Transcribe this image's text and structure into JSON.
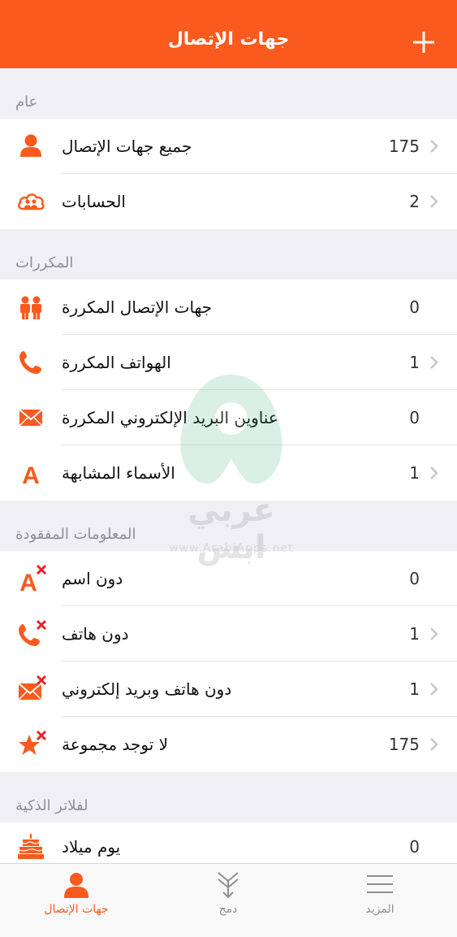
{
  "colors": {
    "accent": "#fa5a1e",
    "cross": "#e8232a",
    "background": "#efeff4"
  },
  "header": {
    "title": "جهات الإتصال",
    "add_icon": "plus-icon"
  },
  "sections": [
    {
      "title": "عام",
      "rows": [
        {
          "label": "جميع جهات الإتصال",
          "count": "175",
          "icon": "person-icon",
          "chevron": true
        },
        {
          "label": "الحسابات",
          "count": "2",
          "icon": "cloud-users-icon",
          "chevron": true
        }
      ]
    },
    {
      "title": "المكررات",
      "rows": [
        {
          "label": "جهات الإتصال المكررة",
          "count": "0",
          "icon": "people-icon",
          "chevron": false
        },
        {
          "label": "الهواتف المكررة",
          "count": "1",
          "icon": "phone-icon",
          "chevron": true
        },
        {
          "label": "عناوين البريد الإلكتروني المكررة",
          "count": "0",
          "icon": "envelope-icon",
          "chevron": false
        },
        {
          "label": "الأسماء المشابهة",
          "count": "1",
          "icon": "letter-a-icon",
          "chevron": true
        }
      ]
    },
    {
      "title": "المعلومات المفقودة",
      "rows": [
        {
          "label": "دون اسم",
          "count": "0",
          "icon": "letter-a-missing-icon",
          "chevron": false
        },
        {
          "label": "دون هاتف",
          "count": "1",
          "icon": "phone-missing-icon",
          "chevron": true
        },
        {
          "label": "دون هاتف وبريد إلكتروني",
          "count": "1",
          "icon": "envelope-missing-icon",
          "chevron": true
        },
        {
          "label": "لا توجد مجموعة",
          "count": "175",
          "icon": "star-missing-icon",
          "chevron": true
        }
      ]
    },
    {
      "title": "لفلاتر الذكية",
      "rows": [
        {
          "label": "يوم ميلاد",
          "count": "0",
          "icon": "birthday-cake-icon",
          "chevron": false
        }
      ]
    }
  ],
  "watermark": {
    "text": "عربي ابس",
    "url": "www.ArabiApps.net"
  },
  "tabbar": {
    "tabs": [
      {
        "label": "المزيد",
        "icon": "menu-icon",
        "active": false
      },
      {
        "label": "دمج",
        "icon": "merge-icon",
        "active": false
      },
      {
        "label": "جهات الإتصال",
        "icon": "person-icon",
        "active": true
      }
    ]
  }
}
